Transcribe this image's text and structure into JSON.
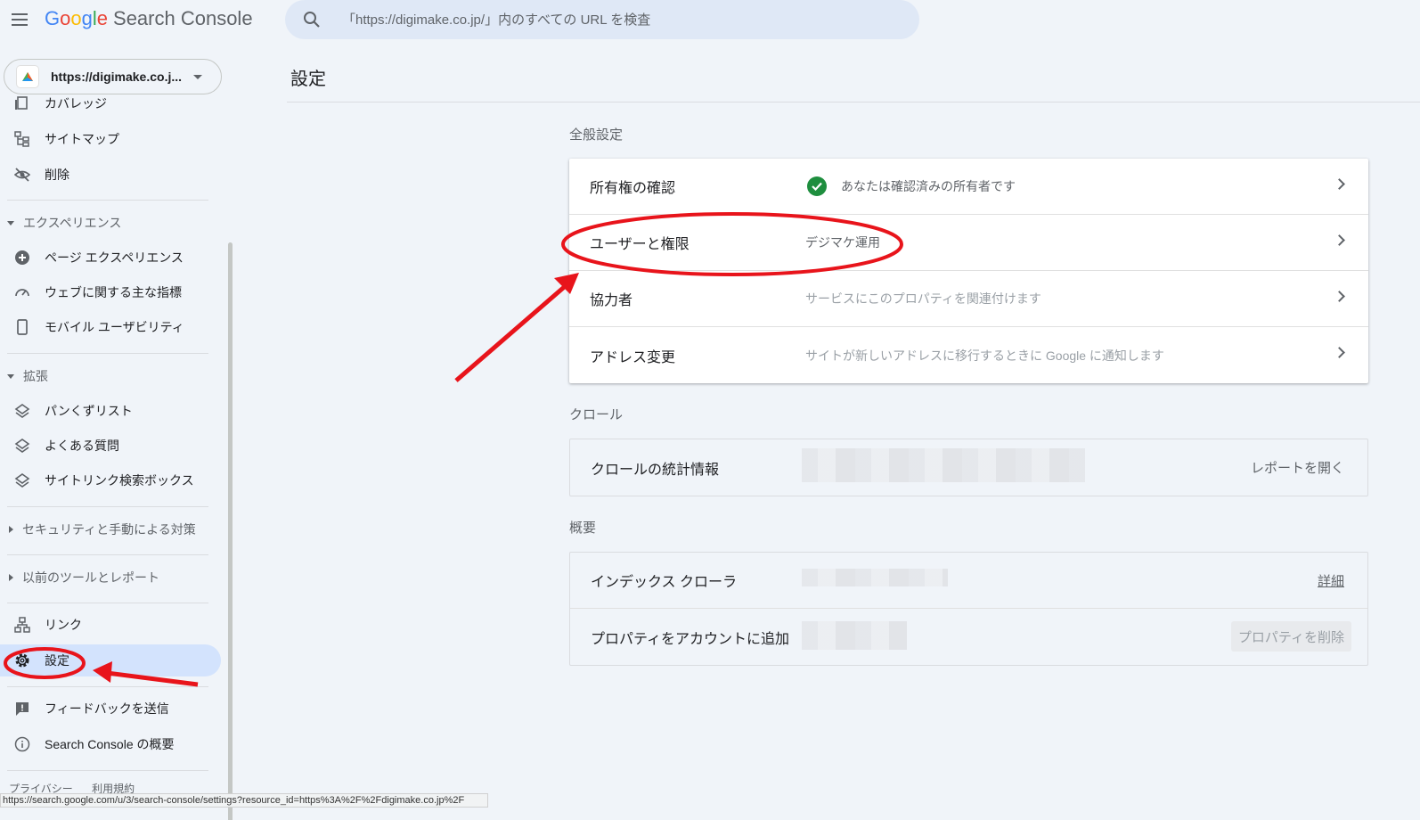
{
  "app": {
    "logo_google": [
      "G",
      "o",
      "o",
      "g",
      "l",
      "e"
    ],
    "logo_product": "Search Console"
  },
  "search": {
    "placeholder": "「https://digimake.co.jp/」内のすべての URL を検査"
  },
  "property": {
    "label": "https://digimake.co.j..."
  },
  "sidebar": {
    "items_top": [
      {
        "label": "カバレッジ",
        "icon": "coverage-icon"
      },
      {
        "label": "サイトマップ",
        "icon": "sitemap-icon"
      },
      {
        "label": "削除",
        "icon": "removals-icon"
      }
    ],
    "experience": {
      "label": "エクスペリエンス",
      "items": [
        {
          "label": "ページ エクスペリエンス",
          "icon": "page-experience-icon"
        },
        {
          "label": "ウェブに関する主な指標",
          "icon": "speedometer-icon"
        },
        {
          "label": "モバイル ユーザビリティ",
          "icon": "phone-icon"
        }
      ]
    },
    "enhancements": {
      "label": "拡張",
      "items": [
        {
          "label": "パンくずリスト",
          "icon": "layers-icon"
        },
        {
          "label": "よくある質問",
          "icon": "layers-icon"
        },
        {
          "label": "サイトリンク検索ボックス",
          "icon": "layers-icon"
        }
      ]
    },
    "security": {
      "label": "セキュリティと手動による対策"
    },
    "legacy": {
      "label": "以前のツールとレポート"
    },
    "links": {
      "label": "リンク"
    },
    "settings": {
      "label": "設定"
    },
    "feedback": {
      "label": "フィードバックを送信"
    },
    "about": {
      "label": "Search Console の概要"
    },
    "footer": {
      "privacy": "プライバシー",
      "terms": "利用規約"
    }
  },
  "status_url": "https://search.google.com/u/3/search-console/settings?resource_id=https%3A%2F%2Fdigimake.co.jp%2F",
  "main": {
    "title": "設定",
    "general": {
      "label": "全般設定",
      "rows": [
        {
          "label": "所有権の確認",
          "value": "あなたは確認済みの所有者です"
        },
        {
          "label": "ユーザーと権限",
          "value": "デジマケ運用"
        },
        {
          "label": "協力者",
          "value": "サービスにこのプロパティを関連付けます"
        },
        {
          "label": "アドレス変更",
          "value": "サイトが新しいアドレスに移行するときに Google に通知します"
        }
      ]
    },
    "crawl": {
      "label": "クロール",
      "row": {
        "label": "クロールの統計情報",
        "action": "レポートを開く"
      }
    },
    "overview": {
      "label": "概要",
      "rows": [
        {
          "label": "インデックス クローラ",
          "action": "詳細"
        },
        {
          "label": "プロパティをアカウントに追加",
          "action": "プロパティを削除"
        }
      ]
    }
  },
  "colors": {
    "accent": "#d3e3fd",
    "check": "#1e8e3e",
    "annotation": "#e8141b"
  }
}
